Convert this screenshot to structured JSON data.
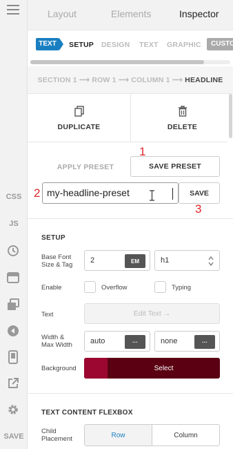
{
  "top_tabs": [
    "Layout",
    "Elements",
    "Inspector"
  ],
  "sub_tabs": {
    "active": "TEXT",
    "items": [
      "SETUP",
      "DESIGN",
      "TEXT",
      "GRAPHIC"
    ],
    "custom": "CUSTOM"
  },
  "breadcrumb": {
    "s1": "SECTION 1",
    "r1": "ROW 1",
    "c1": "COLUMN 1",
    "current": "HEADLINE",
    "arrow": "⟶"
  },
  "actions": {
    "duplicate": "DUPLICATE",
    "delete": "DELETE"
  },
  "preset": {
    "apply": "APPLY PRESET",
    "save_preset": "SAVE PRESET",
    "input_value": "my-headline-preset",
    "save": "SAVE",
    "annotations": [
      "1",
      "2",
      "3"
    ]
  },
  "setup": {
    "title": "SETUP",
    "font_label_1": "Base Font",
    "font_label_2": "Size & Tag",
    "font_size": "2",
    "font_unit": "EM",
    "tag": "h1",
    "enable_label": "Enable",
    "overflow": "Overflow",
    "typing": "Typing",
    "text_label": "Text",
    "edit_text": "Edit Text →",
    "width_label_1": "Width &",
    "width_label_2": "Max Width",
    "width": "auto",
    "max_width": "none",
    "more": "···",
    "background_label": "Background",
    "background_select": "Select"
  },
  "flexbox": {
    "title": "TEXT CONTENT FLEXBOX",
    "child_label_1": "Child",
    "child_label_2": "Placement",
    "row": "Row",
    "column": "Column"
  },
  "rail": {
    "css": "CSS",
    "js": "JS",
    "save": "SAVE"
  },
  "colors": {
    "accent": "#1a7fc1",
    "annotation": "#e0262a",
    "background_swatch": "#9b0730",
    "background_bar": "#5a0012"
  }
}
